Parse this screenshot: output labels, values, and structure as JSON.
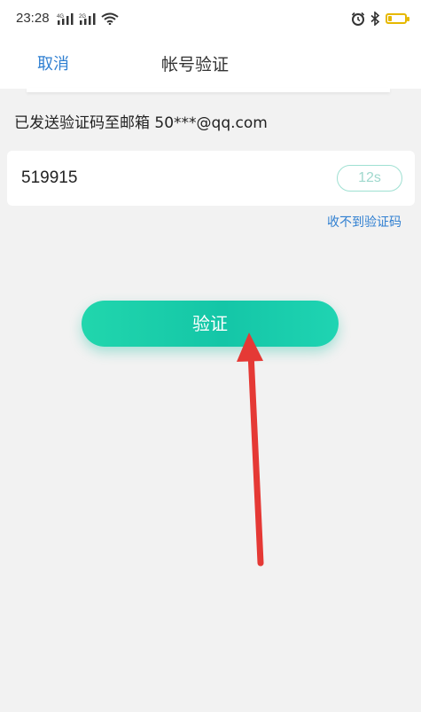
{
  "status_bar": {
    "time": "23:28",
    "signal_1_label": "4G",
    "signal_2_label": "2G",
    "icons": [
      "signal-4g-icon",
      "signal-2g-icon",
      "wifi-icon",
      "alarm-icon",
      "bluetooth-icon",
      "battery-icon"
    ],
    "battery_level": 0.2,
    "battery_color": "#e6b800"
  },
  "nav": {
    "cancel_label": "取消",
    "title": "帐号验证"
  },
  "verification": {
    "sent_info": "已发送验证码至邮箱 50***@qq.com",
    "code_value": "519915",
    "countdown": "12s",
    "resend_label": "收不到验证码",
    "verify_label": "验证"
  },
  "colors": {
    "accent_blue": "#2f7fd1",
    "button_green": "#14c6a7",
    "annotation_red": "#e53935"
  },
  "annotation": {
    "icon": "red-arrow-icon"
  }
}
